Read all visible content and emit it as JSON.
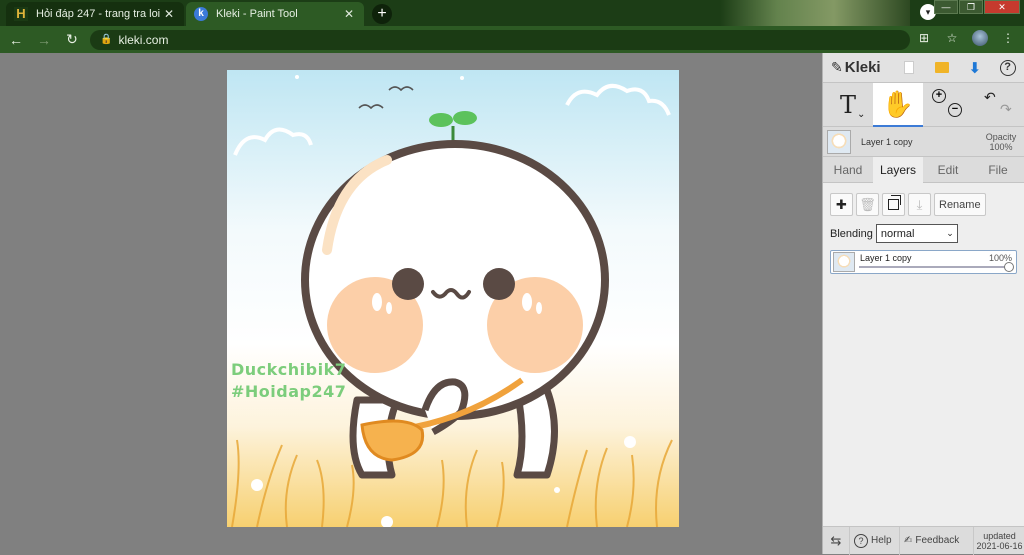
{
  "browser": {
    "tabs": [
      {
        "title": "Hỏi đáp 247 - trang tra loi",
        "favicon": "hoidap-h-icon",
        "active": false
      },
      {
        "title": "Kleki - Paint Tool",
        "favicon": "kleki-icon",
        "active": true
      }
    ],
    "close_glyph": "✕",
    "new_tab_glyph": "+",
    "address": {
      "url": "kleki.com",
      "lock_glyph": "🔒"
    },
    "nav": {
      "back": "←",
      "forward": "→",
      "reload": "↻"
    },
    "toolbar_icons": {
      "translate": "⊞",
      "star": "☆",
      "menu": "⋮"
    },
    "window": {
      "minimize": "—",
      "restore": "❐",
      "close": "✕"
    },
    "profile_drop": "▾"
  },
  "canvas": {
    "watermark_line1": "Duckchibik7",
    "watermark_line2": "#Hoidap247"
  },
  "panel": {
    "logo": {
      "mark": "✎",
      "name": "Kleki"
    },
    "header_icons": {
      "new": "new-image-icon",
      "open": "open-folder-icon",
      "download": "⬇",
      "help": "?"
    },
    "tools": {
      "text": "T",
      "text_sub": "⌄",
      "hand": "✋",
      "zoom_in": "+",
      "zoom_out": "−",
      "undo": "↶",
      "redo": "↷"
    },
    "active_layer": {
      "name": "Layer 1 copy",
      "opacity_label": "Opacity",
      "opacity_value": "100%"
    },
    "tabs": [
      "Hand",
      "Layers",
      "Edit",
      "File"
    ],
    "active_tab": "Layers",
    "layers": {
      "buttons": {
        "add": "✚",
        "delete": "🗑",
        "merge": "⤓",
        "rename": "Rename"
      },
      "blending_label": "Blending",
      "blending_value": "normal",
      "select_arrow": "⌄",
      "items": [
        {
          "name": "Layer 1 copy",
          "opacity": "100%",
          "opacity_fraction": 1.0
        }
      ]
    },
    "footer": {
      "swap": "⇆",
      "help_q": "?",
      "help": "Help",
      "feedback_icon": "✍",
      "feedback": "Feedback",
      "updated_label": "updated",
      "updated_date": "2021-06-16"
    }
  },
  "colors": {
    "chrome_dark": "#1c3d16",
    "chrome": "#2d5a24",
    "canvas_bg": "#808080",
    "panel_bg": "#dcdcdc",
    "accent": "#3c7bd6",
    "watermark": "#7ccd7c"
  }
}
